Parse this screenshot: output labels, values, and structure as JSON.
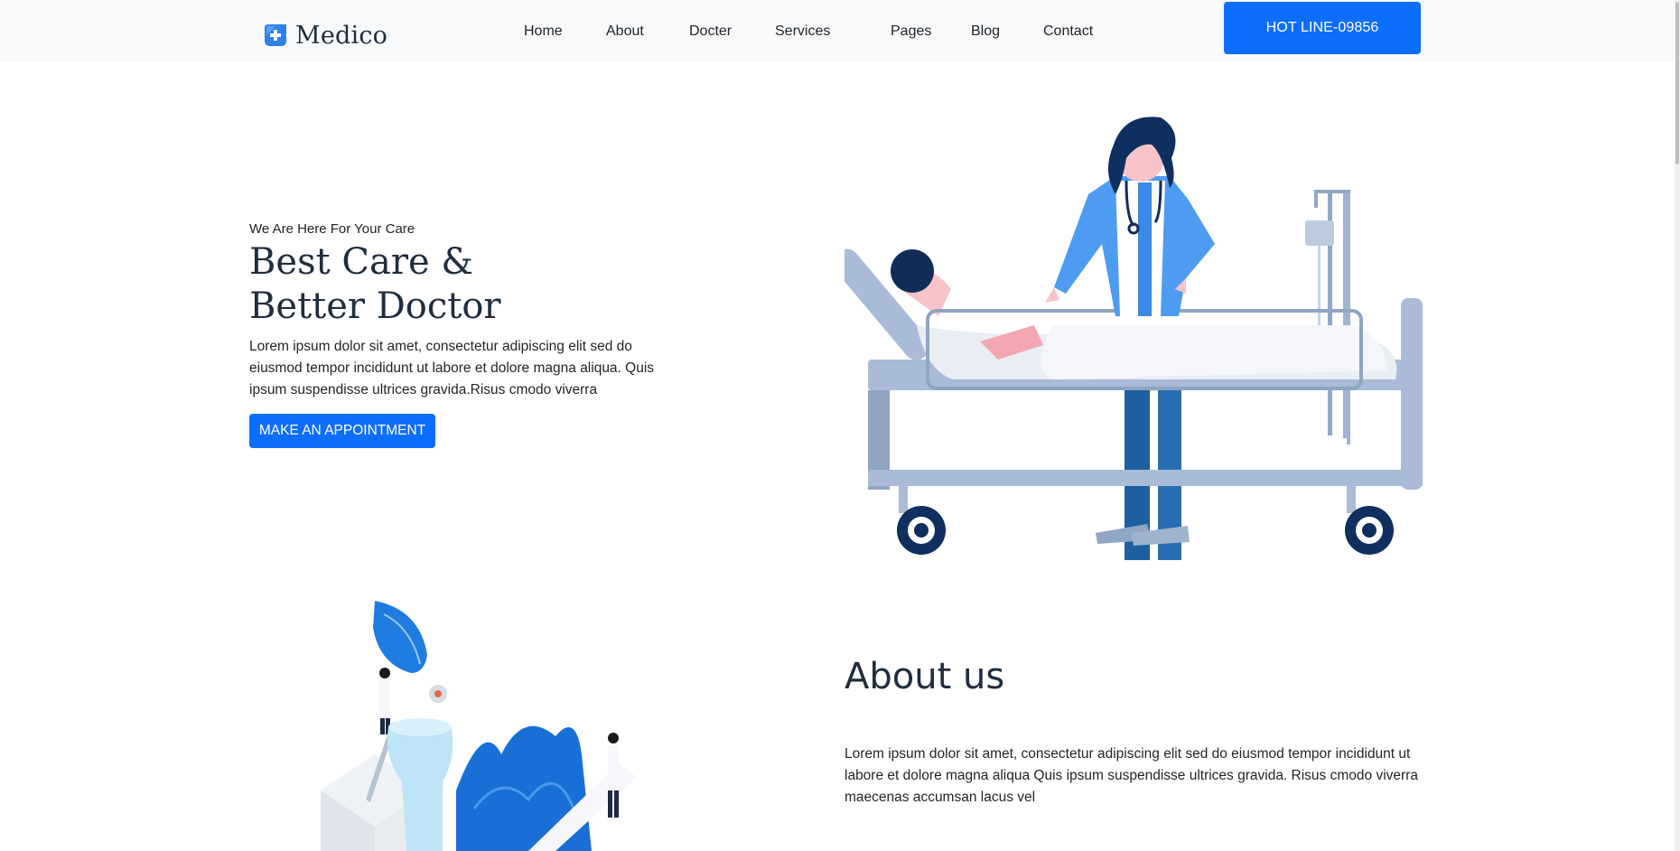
{
  "brand": {
    "name": "Medico",
    "accent": "#0d6efd"
  },
  "nav": {
    "items": [
      "Home",
      "About",
      "Docter",
      "Services",
      "Pages",
      "Blog",
      "Contact"
    ],
    "hotline": "HOT LINE-09856"
  },
  "hero": {
    "eyebrow": "We Are Here For Your Care",
    "title_line1": "Best Care &",
    "title_line2": "Better Doctor",
    "text": "Lorem ipsum dolor sit amet, consectetur adipiscing elit sed do eiusmod tempor incididunt ut labore et dolore magna aliqua. Quis ipsum suspendisse ultrices gravida.Risus cmodo viverra",
    "button": "MAKE AN APPOINTMENT"
  },
  "about": {
    "title": "About us",
    "text": "Lorem ipsum dolor sit amet, consectetur adipiscing elit sed do eiusmod tempor incididunt ut labore et dolore magna aliqua Quis ipsum suspendisse ultrices gravida. Risus cmodo viverra maecenas accumsan lacus vel"
  }
}
